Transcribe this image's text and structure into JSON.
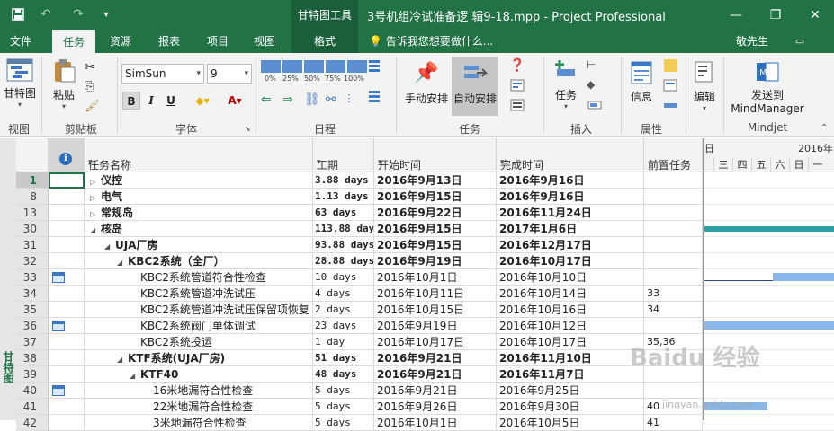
{
  "titlebar": {
    "context_title": "甘特图工具",
    "doc_title": "3号机组冷试准备逻 辑9-18.mpp - Project Professional",
    "minimize": "—",
    "restore": "❐",
    "close": "✕",
    "save_icon": "save-icon",
    "undo_icon": "↶",
    "redo_icon": "↷",
    "qa_more": "▾"
  },
  "tabs": {
    "file": "文件",
    "task": "任务",
    "resource": "资源",
    "report": "报表",
    "project": "项目",
    "view": "视图",
    "format": "格式",
    "tellme": "告诉我您想要做什么...",
    "user": "敬先生"
  },
  "ribbon": {
    "gantt_chart": "甘特图",
    "paste": "粘贴",
    "font_name": "SimSun",
    "font_size": "9",
    "bold": "B",
    "italic": "I",
    "underline": "U",
    "pct0": "0%",
    "pct25": "25%",
    "pct50": "50%",
    "pct75": "75%",
    "pct100": "100%",
    "manual_schedule": "手动安排",
    "auto_schedule": "自动安排",
    "task_btn": "任务",
    "info_btn": "信息",
    "edit_btn": "编辑",
    "mindjet_btn_line1": "发送到",
    "mindjet_btn_line2": "MindManager",
    "groups": {
      "view": "视图",
      "clipboard": "剪贴板",
      "font": "字体",
      "schedule": "日程",
      "tasks": "任务",
      "insert": "插入",
      "properties": "属性",
      "mindjet": "Mindjet"
    }
  },
  "columns": {
    "name": "任务名称",
    "duration": "工期",
    "start": "开始时间",
    "finish": "完成时间",
    "predecessors": "前置任务"
  },
  "side_label": "甘特图",
  "gantt": {
    "year_label": "2016年1",
    "day_label_left": "日",
    "days": [
      "三",
      "四",
      "五",
      "六",
      "日",
      "一"
    ]
  },
  "rows": [
    {
      "id": "1",
      "name": "仪控",
      "dur": "3.88 days",
      "start": "2016年9月13日",
      "finish": "2016年9月16日",
      "pred": "",
      "level": 0,
      "bold": true,
      "collapsed": true,
      "cal": false,
      "sel": true
    },
    {
      "id": "8",
      "name": "电气",
      "dur": "1.13 days",
      "start": "2016年9月15日",
      "finish": "2016年9月16日",
      "pred": "",
      "level": 0,
      "bold": true,
      "collapsed": true,
      "cal": false
    },
    {
      "id": "13",
      "name": "常规岛",
      "dur": "63 days",
      "start": "2016年9月22日",
      "finish": "2016年11月24日",
      "pred": "",
      "level": 0,
      "bold": true,
      "collapsed": true,
      "cal": false
    },
    {
      "id": "30",
      "name": "核岛",
      "dur": "113.88 days",
      "start": "2016年9月15日",
      "finish": "2017年1月6日",
      "pred": "",
      "level": 0,
      "bold": true,
      "expanded": true,
      "cal": false
    },
    {
      "id": "31",
      "name": "UJA厂房",
      "dur": "93.88 days",
      "start": "2016年9月15日",
      "finish": "2016年12月17日",
      "pred": "",
      "level": 1,
      "bold": true,
      "expanded": true,
      "cal": false
    },
    {
      "id": "32",
      "name": "KBC2系统（全厂）",
      "dur": "28.88 days",
      "start": "2016年9月19日",
      "finish": "2016年10月17日",
      "pred": "",
      "level": 2,
      "bold": true,
      "expanded": true,
      "cal": false
    },
    {
      "id": "33",
      "name": "KBC2系统管道符合性检查",
      "dur": "10 days",
      "start": "2016年10月1日",
      "finish": "2016年10月10日",
      "pred": "",
      "level": 3,
      "bold": false,
      "cal": true
    },
    {
      "id": "34",
      "name": "KBC2系统管道冲洗试压",
      "dur": "4 days",
      "start": "2016年10月11日",
      "finish": "2016年10月14日",
      "pred": "33",
      "level": 3,
      "bold": false,
      "cal": false
    },
    {
      "id": "35",
      "name": "KBC2系统管道冲洗试压保留项恢复",
      "dur": "2 days",
      "start": "2016年10月15日",
      "finish": "2016年10月16日",
      "pred": "34",
      "level": 3,
      "bold": false,
      "cal": false
    },
    {
      "id": "36",
      "name": "KBC2系统阀门单体调试",
      "dur": "23 days",
      "start": "2016年9月19日",
      "finish": "2016年10月12日",
      "pred": "",
      "level": 3,
      "bold": false,
      "cal": true
    },
    {
      "id": "37",
      "name": "KBC2系统投运",
      "dur": "1 day",
      "start": "2016年10月17日",
      "finish": "2016年10月17日",
      "pred": "35,36",
      "level": 3,
      "bold": false,
      "cal": false
    },
    {
      "id": "38",
      "name": "KTF系统(UJA厂房)",
      "dur": "51 days",
      "start": "2016年9月21日",
      "finish": "2016年11月10日",
      "pred": "",
      "level": 2,
      "bold": true,
      "expanded": true,
      "cal": false
    },
    {
      "id": "39",
      "name": "KTF40",
      "dur": "48 days",
      "start": "2016年9月21日",
      "finish": "2016年11月7日",
      "pred": "",
      "level": 3,
      "bold": true,
      "expanded": true,
      "cal": false
    },
    {
      "id": "40",
      "name": "16米地漏符合性检查",
      "dur": "5 days",
      "start": "2016年9月21日",
      "finish": "2016年9月25日",
      "pred": "",
      "level": 4,
      "bold": false,
      "cal": true
    },
    {
      "id": "41",
      "name": "22米地漏符合性检查",
      "dur": "5 days",
      "start": "2016年9月26日",
      "finish": "2016年9月30日",
      "pred": "40",
      "level": 4,
      "bold": false,
      "cal": false
    },
    {
      "id": "42",
      "name": "3米地漏符合性检查",
      "dur": "5 days",
      "start": "2016年10月1日",
      "finish": "2016年10月5日",
      "pred": "41",
      "level": 4,
      "bold": false,
      "cal": false
    }
  ],
  "watermark": "Baidu 经验",
  "watermark_url": "jingyan.baidu.com",
  "colors": {
    "brand": "#217346",
    "bar": "#8ab7ea",
    "teal": "#2b9fa3"
  }
}
